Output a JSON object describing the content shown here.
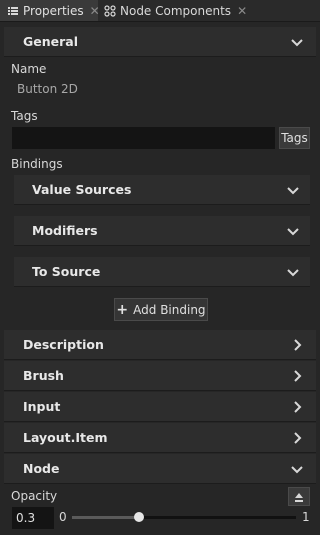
{
  "tabs": [
    {
      "label": "Properties",
      "icon": "list-icon",
      "active": true
    },
    {
      "label": "Node Components",
      "icon": "node-components-icon",
      "active": false
    }
  ],
  "general": {
    "title": "General",
    "name_label": "Name",
    "name_value": "Button 2D",
    "tags_label": "Tags",
    "tags_value": "",
    "tags_button": "Tags",
    "bindings_label": "Bindings",
    "bindings": [
      {
        "label": "Value Sources"
      },
      {
        "label": "Modifiers"
      },
      {
        "label": "To Source"
      }
    ],
    "add_binding_label": "Add Binding"
  },
  "sections": [
    {
      "label": "Description",
      "expanded": false
    },
    {
      "label": "Brush",
      "expanded": false
    },
    {
      "label": "Input",
      "expanded": false
    },
    {
      "label": "Layout.Item",
      "expanded": false
    },
    {
      "label": "Node",
      "expanded": true
    }
  ],
  "node": {
    "opacity_label": "Opacity",
    "opacity_value": "0.3",
    "slider_min": "0",
    "slider_max": "1",
    "slider_fraction": 0.3
  },
  "colors": {
    "background": "#262626",
    "section": "#2d2d2d",
    "input": "#141414"
  }
}
